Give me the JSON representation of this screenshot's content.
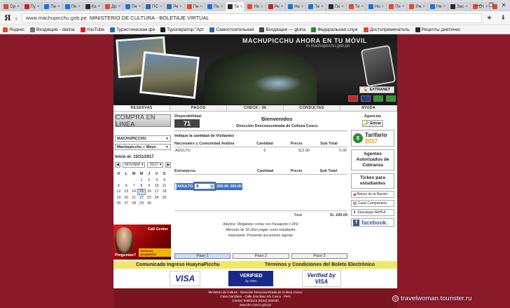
{
  "browser": {
    "tabs": [
      {
        "title": "Ор",
        "color": "#e24a2a",
        "active": false
      },
      {
        "title": "Пу",
        "color": "#cc1e1e",
        "active": false
      },
      {
        "title": "Пе",
        "color": "#1a73d9",
        "active": false
      },
      {
        "title": "Пе",
        "color": "#1a73d9",
        "active": false
      },
      {
        "title": "Ка",
        "color": "#2a2a2a",
        "active": false
      },
      {
        "title": "Др",
        "color": "#e24a2a",
        "active": false
      },
      {
        "title": "Пе",
        "color": "#1a73d9",
        "active": false
      },
      {
        "title": "ПС",
        "color": "#2a6ab0",
        "active": false
      },
      {
        "title": "Ре",
        "color": "#2a6ab0",
        "active": false
      },
      {
        "title": "Пе",
        "color": "#e24a2a",
        "active": false
      },
      {
        "title": "Пе",
        "color": "#1a73d9",
        "active": false
      },
      {
        "title": "Те",
        "color": "#2a2a2a",
        "active": true
      },
      {
        "title": "Но",
        "color": "#e24a2a",
        "active": false
      },
      {
        "title": "Ре",
        "color": "#cc1e1e",
        "active": false
      },
      {
        "title": "Не",
        "color": "#1a73d9",
        "active": false
      },
      {
        "title": "Те",
        "color": "#1a73d9",
        "active": false
      },
      {
        "title": "Пи",
        "color": "#2a2a2a",
        "active": false
      },
      {
        "title": "Те",
        "color": "#e24a2a",
        "active": false
      },
      {
        "title": "Но",
        "color": "#1a73d9",
        "active": false
      },
      {
        "title": "Пе",
        "color": "#e24a2a",
        "active": false
      },
      {
        "title": "Рж",
        "color": "#e24a2a",
        "active": false
      },
      {
        "title": "Не",
        "color": "#1a73d9",
        "active": false
      },
      {
        "title": "Зас",
        "color": "#2a2a2a",
        "active": false
      },
      {
        "title": "От",
        "color": "#e24a2a",
        "active": false
      },
      {
        "title": "Ка",
        "color": "#e24a2a",
        "active": false
      },
      {
        "title": "Ре",
        "color": "#cc1e1e",
        "active": false
      },
      {
        "title": "ая",
        "color": "#e24a2a",
        "active": false
      }
    ],
    "window_controls": {
      "minimize": "—",
      "maximize": "❐",
      "close": "✕"
    },
    "logo": "Я",
    "url_domain": "www.machupicchu.gob.pe",
    "page_title": "MINISTERIO DE CULTURA - BOLETAJE VIRTUAL",
    "bookmarks": [
      {
        "label": "Яндекс",
        "color": "#e24a2a"
      },
      {
        "label": "Входящие - darina",
        "color": "#777"
      },
      {
        "label": "YouTube",
        "color": "#e02020"
      },
      {
        "label": "Туристическая фи",
        "color": "#2a6ab0"
      },
      {
        "label": "Туроператор \"Арт",
        "color": "#1a1a1a"
      },
      {
        "label": "Самостоятельная",
        "color": "#2a6ab0"
      },
      {
        "label": "Входящие — gloria",
        "color": "#444"
      },
      {
        "label": "Федеральная служ",
        "color": "#2a8a2a"
      },
      {
        "label": "Достопримечатель",
        "color": "#e24a2a"
      },
      {
        "label": "Рецепты диетичес",
        "color": "#2a2a2a"
      }
    ]
  },
  "banner": {
    "heading": "MACHUPICCHU AHORA EN TU MÓVIL",
    "subheading": "m.machupicchu.gob.pe",
    "extranet": "EXTRANET"
  },
  "flags": [
    {
      "name": "spain",
      "color": "#d32020"
    },
    {
      "name": "uk",
      "color": "#2a3a8a"
    },
    {
      "name": "brazil",
      "color": "#2a9a2a"
    },
    {
      "name": "italy",
      "color": "#2aa02a"
    }
  ],
  "menu": [
    "RESERVAS",
    "PAGOS",
    "CHECK - IN",
    "CONSULTAS",
    "AYUDA"
  ],
  "left": {
    "compra": "COMPRA EN LINEA",
    "lugar": "MACHUPICCHU",
    "ruta": "Machupicchu + Wayn",
    "inicio_label": "Inicio el:",
    "inicio_date": "15/11/2017",
    "month": "NOVIEM",
    "year": "2017",
    "prev": "◀",
    "next": "▶",
    "weekdays": [
      "D",
      "L",
      "M",
      "M",
      "J",
      "V",
      "S"
    ],
    "weeks": [
      [
        "",
        "",
        "",
        "1",
        "2",
        "3",
        "4"
      ],
      [
        "5",
        "6",
        "7",
        "8",
        "9",
        "10",
        "11"
      ],
      [
        "12",
        "13",
        "14",
        "15",
        "16",
        "17",
        "18"
      ],
      [
        "19",
        "20",
        "21",
        "22",
        "23",
        "24",
        "25"
      ],
      [
        "26",
        "27",
        "28",
        "29",
        "30",
        "",
        ""
      ]
    ],
    "today": "15",
    "call_center": "Call Center",
    "preguntas": "Preguntas?",
    "phone": "Teléfonos (084)582030"
  },
  "center": {
    "disp_label": "Disponibilidad:",
    "disp_value": "71",
    "bienvenidos": "Bienvenidos",
    "direccion": "Dirección Desconcentrada de Cultura Cusco",
    "indique": "Indique la cantidad de Visitantes",
    "nac_table": {
      "headers": [
        "Nacionales y Comunidad Andina",
        "Cantidad",
        "Precio",
        "Sub Total"
      ],
      "rows": [
        [
          "ADULTO",
          "0",
          "112.00",
          "0.00"
        ]
      ]
    },
    "ext_table": {
      "headers": [
        "Extranjeros",
        "Cantidad",
        "Precio",
        "Sub Total"
      ],
      "rows": [
        [
          "ADULTO",
          "0",
          "200.00",
          "200.00"
        ]
      ]
    },
    "total_label": "Total",
    "total_value": "S/. 200.00",
    "note1": "Adultos: Obligatorio contar con Pasaporte ó DNI.",
    "note2": "Menores de 18 años pagan como estudiante.",
    "note3": "Importante: Presentar documento vigente.",
    "steps": [
      "Paso 1",
      "Paso 2",
      "Paso 3"
    ]
  },
  "right": {
    "agencias": "Agencias",
    "entrar": "Entrar",
    "tarifario": "Tarifario",
    "tarifario_year": "2017",
    "agentes": "Agentes Autorizados de Cobranza",
    "tickets": "Tickes para estudiantes",
    "banco": "Banco de la Nación",
    "carta": "Carta Compromiso",
    "descargar": "Descargar NAHUI",
    "facebook": "facebook."
  },
  "yellow_bar": {
    "left": "Comunicado Ingreso HuaynaPicchu",
    "right": "Términos y Condiciones del Boleto Electrónico"
  },
  "cards": {
    "visa": "VISA",
    "vbv_top": "VERIFIED",
    "vbv_bottom": "by VISA",
    "vbv2_top": "Verified by",
    "vbv2_bottom": "VISA"
  },
  "footer": {
    "line1": "Ministerio de Cultura - Dirección Desconcentrada de Cultura Cusco",
    "line2": "Casa Garcilaso - Calle Garcilaso s/n Cusco - Perú",
    "line3": "Central Telefónica (5184) 582030",
    "line4": "www.drc-cusco.gob.pe"
  },
  "watermark": "travelwoman.tourister.ru"
}
